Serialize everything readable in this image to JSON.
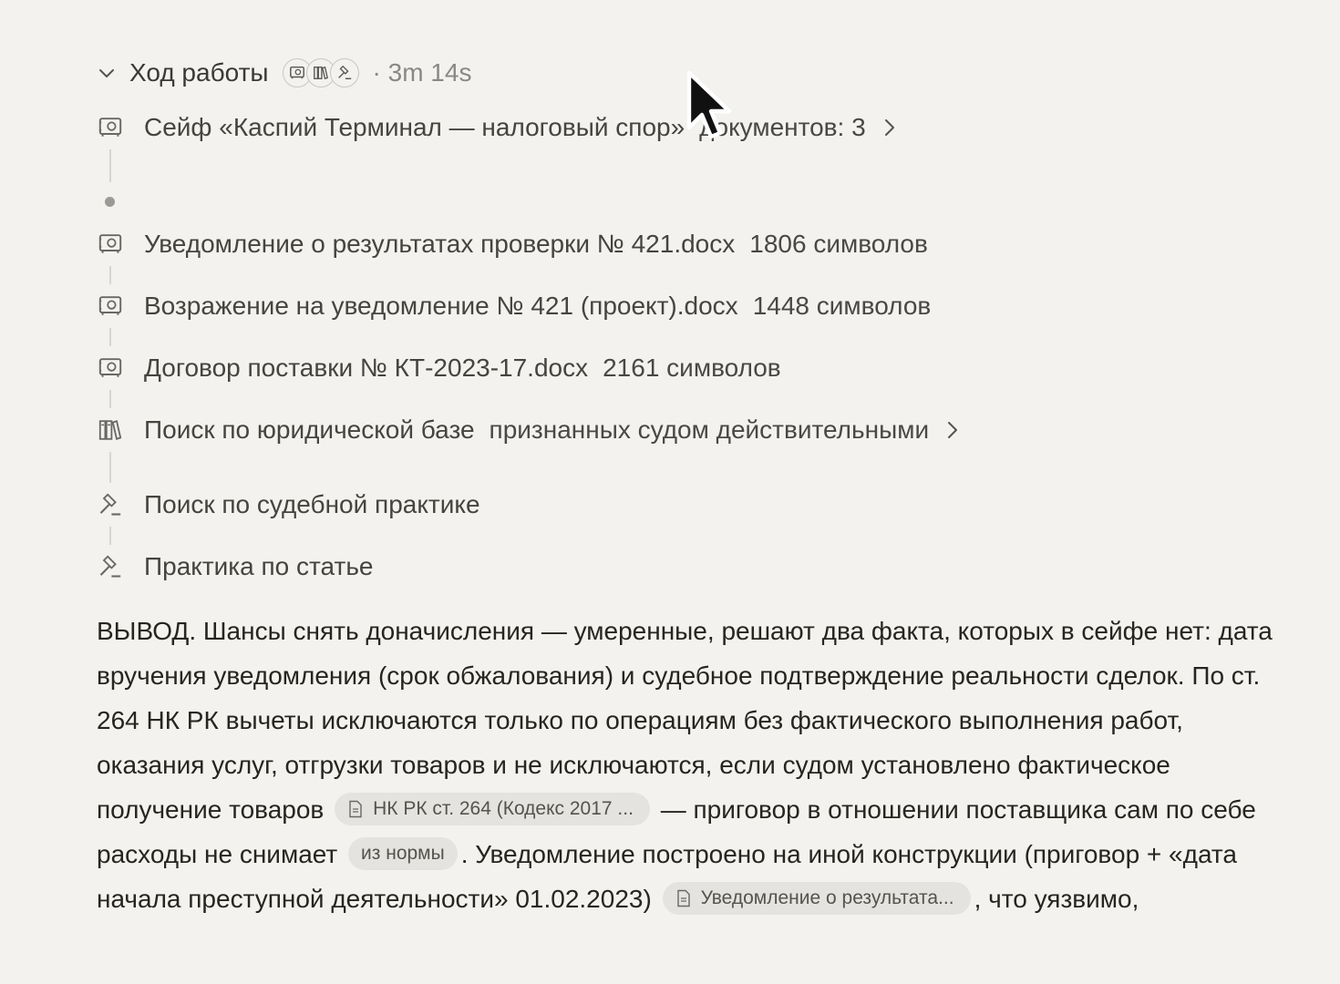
{
  "header": {
    "title": "Ход работы",
    "duration": "· 3m 14s",
    "tools": [
      "vault-icon",
      "library-icon",
      "gavel-icon"
    ]
  },
  "steps": [
    {
      "icon": "vault-icon",
      "label": "Сейф «Каспий Терминал — налоговый спор»",
      "meta": "документов: 3",
      "expandable": true
    },
    {
      "icon": "vault-icon",
      "label": "Уведомление о результатах проверки № 421.docx",
      "meta": "1806 символов"
    },
    {
      "icon": "vault-icon",
      "label": "Возражение на уведомление № 421 (проект).docx",
      "meta": "1448 символов"
    },
    {
      "icon": "vault-icon",
      "label": "Договор поставки № КТ-2023-17.docx",
      "meta": "2161 символов"
    },
    {
      "icon": "library-icon",
      "label": "Поиск по юридической базе",
      "meta": "признанных судом действительными",
      "expandable": true
    },
    {
      "icon": "gavel-icon",
      "label": "Поиск по судебной практике",
      "meta": ""
    },
    {
      "icon": "gavel-icon",
      "label": "Практика по статье",
      "meta": ""
    }
  ],
  "conclusion": {
    "part1": "ВЫВОД. Шансы снять доначисления — умеренные, решают два факта, которых в сейфе нет: дата вручения уведомления (срок обжалования) и судебное подтверждение реальности сделок. По ст. 264 НК РК вычеты исключаются только по операциям без фактического выполнения работ, оказания услуг, отгрузки товаров и не исключаются, если судом установлено фактическое получение товаров",
    "chip1": "НК РК ст. 264 (Кодекс 2017 ...",
    "part2": "— приговор в отношении поставщика сам по себе расходы не снимает",
    "chip2": "из нормы",
    "part3": ". Уведомление построено на иной конструкции (приговор + «дата начала преступной деятельности» 01.02.2023)",
    "chip3": "Уведомление о результата...",
    "part4": ", что уязвимо,"
  },
  "colors": {
    "background": "#f3f2ef",
    "text": "#26251f",
    "muted": "#8a8884",
    "chip": "#e5e3df"
  }
}
